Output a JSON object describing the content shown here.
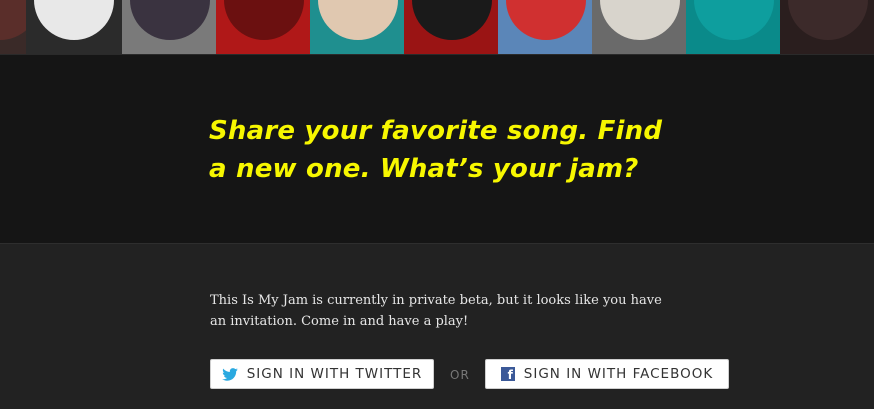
{
  "album_strip": {
    "tiles": [
      {
        "icon": "album-cover-art",
        "colors": [
          "#3a2a28",
          "#5a2e2a"
        ]
      },
      {
        "icon": "album-cover-art",
        "colors": [
          "#2b2b2b",
          "#e8e8e8"
        ]
      },
      {
        "icon": "album-cover-art",
        "colors": [
          "#7a7a7a",
          "#3a3340"
        ]
      },
      {
        "icon": "album-cover-art",
        "colors": [
          "#b01818",
          "#6b1010"
        ]
      },
      {
        "icon": "album-cover-art",
        "colors": [
          "#1f8f8f",
          "#e0c8b0"
        ]
      },
      {
        "icon": "album-cover-art",
        "colors": [
          "#9a1414",
          "#1a1a1a"
        ]
      },
      {
        "icon": "album-cover-art",
        "colors": [
          "#5b86b8",
          "#d03030"
        ]
      },
      {
        "icon": "album-cover-art",
        "colors": [
          "#6a6a6a",
          "#d8d4cc"
        ]
      },
      {
        "icon": "album-cover-art",
        "colors": [
          "#0a8a8a",
          "#0e9e9e"
        ]
      },
      {
        "icon": "album-cover-art",
        "colors": [
          "#2a1e1e",
          "#3c2a2a"
        ]
      }
    ]
  },
  "hero": {
    "headline": "Share your favorite song. Find a new one. What’s your jam?"
  },
  "intro": {
    "text": "This Is My Jam is currently in private beta, but it looks like you have an invitation. Come in and have a play!"
  },
  "signin": {
    "twitter_label": "SIGN IN WITH TWITTER",
    "twitter_icon": "twitter-bird-icon",
    "twitter_color": "#2aa9e0",
    "or_label": "OR",
    "facebook_label": "SIGN IN WITH FACEBOOK",
    "facebook_icon": "facebook-icon",
    "facebook_color": "#3b5998"
  }
}
